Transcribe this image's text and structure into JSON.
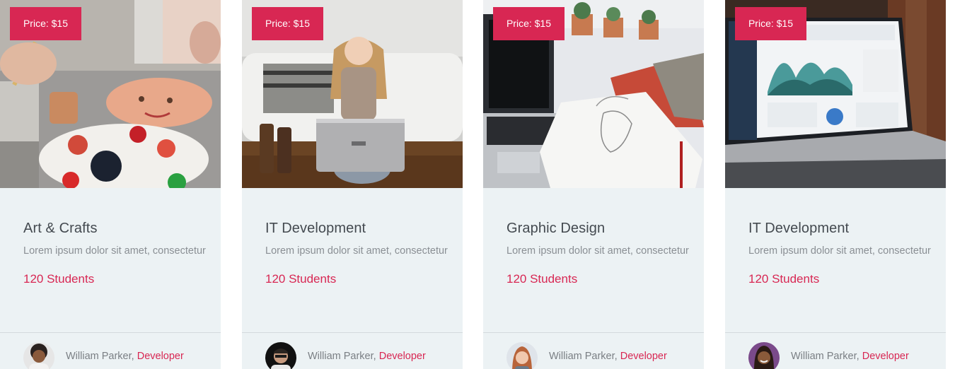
{
  "colors": {
    "accent": "#d82753",
    "card_background": "#ecf2f4",
    "title_text": "#444a50",
    "muted_text": "#8a8f94"
  },
  "courses": [
    {
      "price": "Price: $15",
      "title": "Art & Crafts",
      "description": "Lorem ipsum dolor sit amet, consectetur",
      "students": "120 Students",
      "author_name": "William Parker,",
      "author_role": "Developer"
    },
    {
      "price": "Price: $15",
      "title": "IT Development",
      "description": "Lorem ipsum dolor sit amet, consectetur",
      "students": "120 Students",
      "author_name": "William Parker,",
      "author_role": "Developer"
    },
    {
      "price": "Price: $15",
      "title": "Graphic Design",
      "description": "Lorem ipsum dolor sit amet, consectetur",
      "students": "120 Students",
      "author_name": "William Parker,",
      "author_role": "Developer"
    },
    {
      "price": "Price: $15",
      "title": "IT Development",
      "description": "Lorem ipsum dolor sit amet, consectetur",
      "students": "120 Students",
      "author_name": "William Parker,",
      "author_role": "Developer"
    }
  ]
}
